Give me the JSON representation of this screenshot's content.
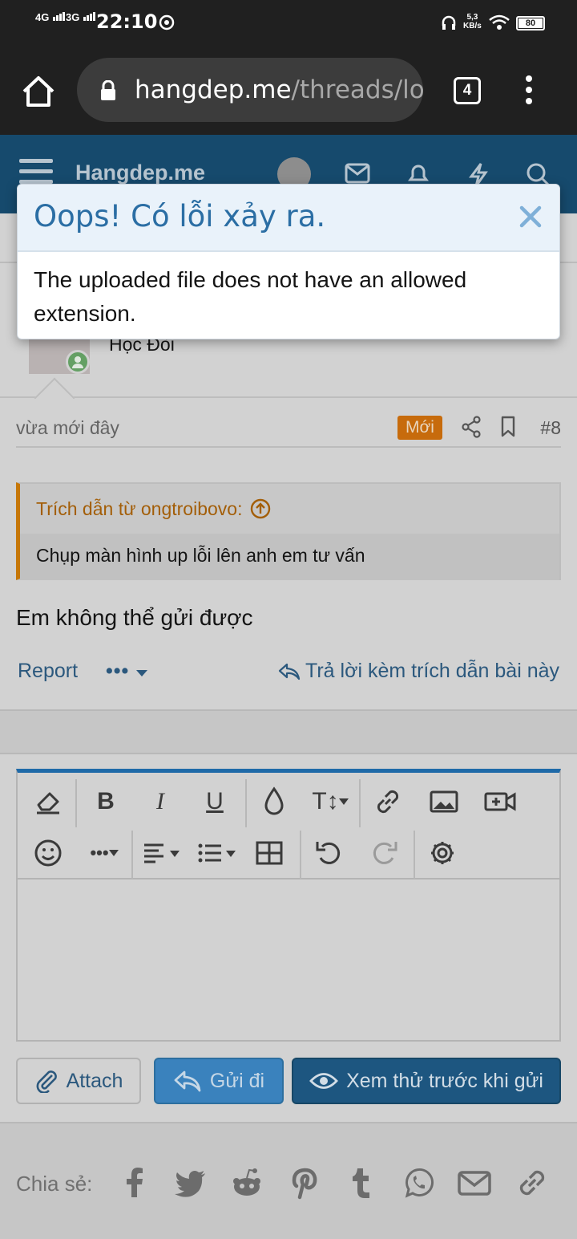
{
  "status_bar": {
    "network_1": "4G",
    "network_2": "3G",
    "time": "22:10",
    "speed_value": "5,3",
    "speed_unit": "KB/s",
    "battery": "80"
  },
  "browser": {
    "url_host": "hangdep.me",
    "url_path": "/threads/loa",
    "tab_count": "4"
  },
  "site": {
    "name": "Hangdep.me"
  },
  "post": {
    "author_title": "Học Đòi",
    "time": "vừa mới đây",
    "badge": "Mới",
    "number": "#8",
    "quote_header": "Trích dẫn từ ongtroibovo:",
    "quote_text": "Chụp màn hình up lỗi lên anh em tư vấn",
    "message": "Em không thể gửi được",
    "report_label": "Report",
    "more_label": "•••",
    "reply_quote_label": "Trả lời kèm trích dẫn bài này"
  },
  "editor": {
    "tool_bold": "B",
    "tool_italic": "I",
    "tool_underline": "U",
    "tool_text_size": "T↕",
    "tool_more": "•••",
    "attach_label": "Attach",
    "send_label": "Gửi đi",
    "preview_label": "Xem thử trước khi gửi"
  },
  "share": {
    "label": "Chia sẻ:"
  },
  "modal": {
    "title": "Oops! Có lỗi xảy ra.",
    "message": "The uploaded file does not have an allowed extension."
  },
  "colors": {
    "brand_header": "#164a6d",
    "modal_title": "#2b6ea4",
    "accent_orange": "#c76b0c",
    "primary_button": "#1d5680"
  }
}
